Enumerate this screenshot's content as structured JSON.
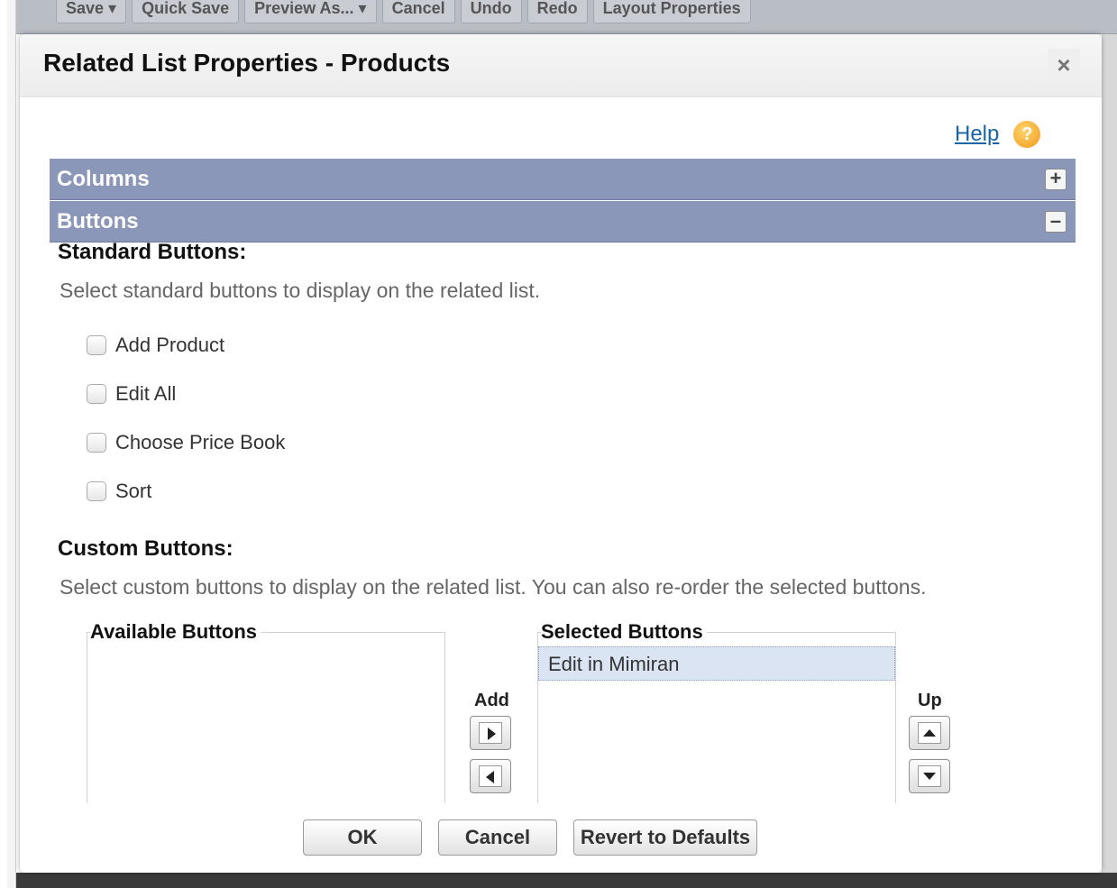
{
  "background": {
    "toolbar": [
      "Save ▾",
      "Quick Save",
      "Preview As... ▾",
      "Cancel",
      "Undo",
      "Redo",
      "Layout Properties"
    ]
  },
  "modal": {
    "title": "Related List Properties - Products",
    "close_label": "×",
    "help_label": "Help",
    "help_icon": "?"
  },
  "sections": {
    "columns": {
      "label": "Columns",
      "toggle": "+"
    },
    "buttons": {
      "label": "Buttons",
      "toggle": "–"
    }
  },
  "standard": {
    "heading": "Standard Buttons:",
    "instruction": "Select standard buttons to display on the related list.",
    "options": [
      "Add Product",
      "Edit All",
      "Choose Price Book",
      "Sort"
    ]
  },
  "custom": {
    "heading": "Custom Buttons:",
    "instruction": "Select custom buttons to display on the related list. You can also re-order the selected buttons.",
    "available_title": "Available Buttons",
    "selected_title": "Selected Buttons",
    "selected_items": [
      "Edit in Mimiran"
    ],
    "add_label": "Add",
    "up_label": "Up"
  },
  "footer": {
    "ok": "OK",
    "cancel": "Cancel",
    "revert": "Revert to Defaults"
  }
}
